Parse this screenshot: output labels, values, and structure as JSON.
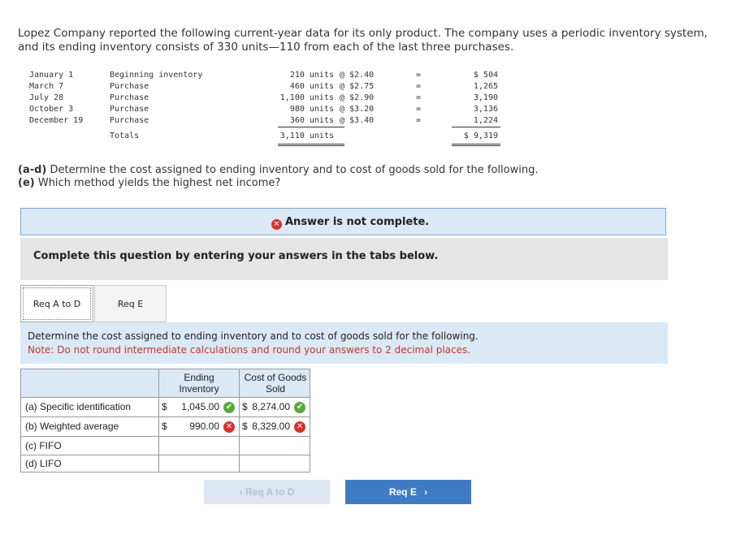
{
  "intro": "Lopez Company reported the following current-year data for its only product. The company uses a periodic inventory system, and its ending inventory consists of 330 units—110 from each of the last three purchases.",
  "inventory_rows": [
    {
      "date": "January 1",
      "desc": "Beginning inventory",
      "units": "210 units",
      "at": "@ $2.40",
      "eq": "=",
      "total": "$ 504"
    },
    {
      "date": "March 7",
      "desc": "Purchase",
      "units": "460 units",
      "at": "@ $2.75",
      "eq": "=",
      "total": "1,265"
    },
    {
      "date": "July 28",
      "desc": "Purchase",
      "units": "1,100 units",
      "at": "@ $2.90",
      "eq": "=",
      "total": "3,190"
    },
    {
      "date": "October 3",
      "desc": "Purchase",
      "units": "980 units",
      "at": "@ $3.20",
      "eq": "=",
      "total": "3,136"
    },
    {
      "date": "December 19",
      "desc": "Purchase",
      "units": "360 units",
      "at": "@ $3.40",
      "eq": "=",
      "total": "1,224"
    }
  ],
  "totals": {
    "label": "Totals",
    "units": "3,110 units",
    "total": "$ 9,319"
  },
  "question": {
    "a_d_label": "(a-d)",
    "a_d_text": " Determine the cost assigned to ending inventory and to cost of goods sold for the following.",
    "e_label": "(e)",
    "e_text": " Which method yields the highest net income?"
  },
  "notice": "Answer is not complete.",
  "complete_text": "Complete this question by entering your answers in the tabs below.",
  "tabs": [
    {
      "label": "Req A to D"
    },
    {
      "label": "Req E"
    }
  ],
  "instruction": "Determine the cost assigned to ending inventory and to cost of goods sold for the following.",
  "note": "Note: Do not round intermediate calculations and round your answers to 2 decimal places.",
  "answer_table": {
    "col1": "Ending Inventory",
    "col2": "Cost of Goods Sold",
    "rows": [
      {
        "label": "(a) Specific identification",
        "ei_dollar": "$",
        "ei": "1,045.00",
        "ei_status": "correct",
        "cogs_dollar": "$",
        "cogs": "8,274.00",
        "cogs_status": "correct"
      },
      {
        "label": "(b) Weighted average",
        "ei_dollar": "$",
        "ei": "990.00",
        "ei_status": "incorrect",
        "cogs_dollar": "$",
        "cogs": "8,329.00",
        "cogs_status": "incorrect"
      },
      {
        "label": "(c) FIFO",
        "ei_dollar": "",
        "ei": "",
        "cogs_dollar": "",
        "cogs": ""
      },
      {
        "label": "(d) LIFO",
        "ei_dollar": "",
        "ei": "",
        "cogs_dollar": "",
        "cogs": ""
      }
    ]
  },
  "nav": {
    "prev": "Req A to D",
    "next": "Req E"
  },
  "icons": {
    "x": "✕",
    "check": "✔",
    "prev_chevron": "‹",
    "next_chevron": "›"
  }
}
